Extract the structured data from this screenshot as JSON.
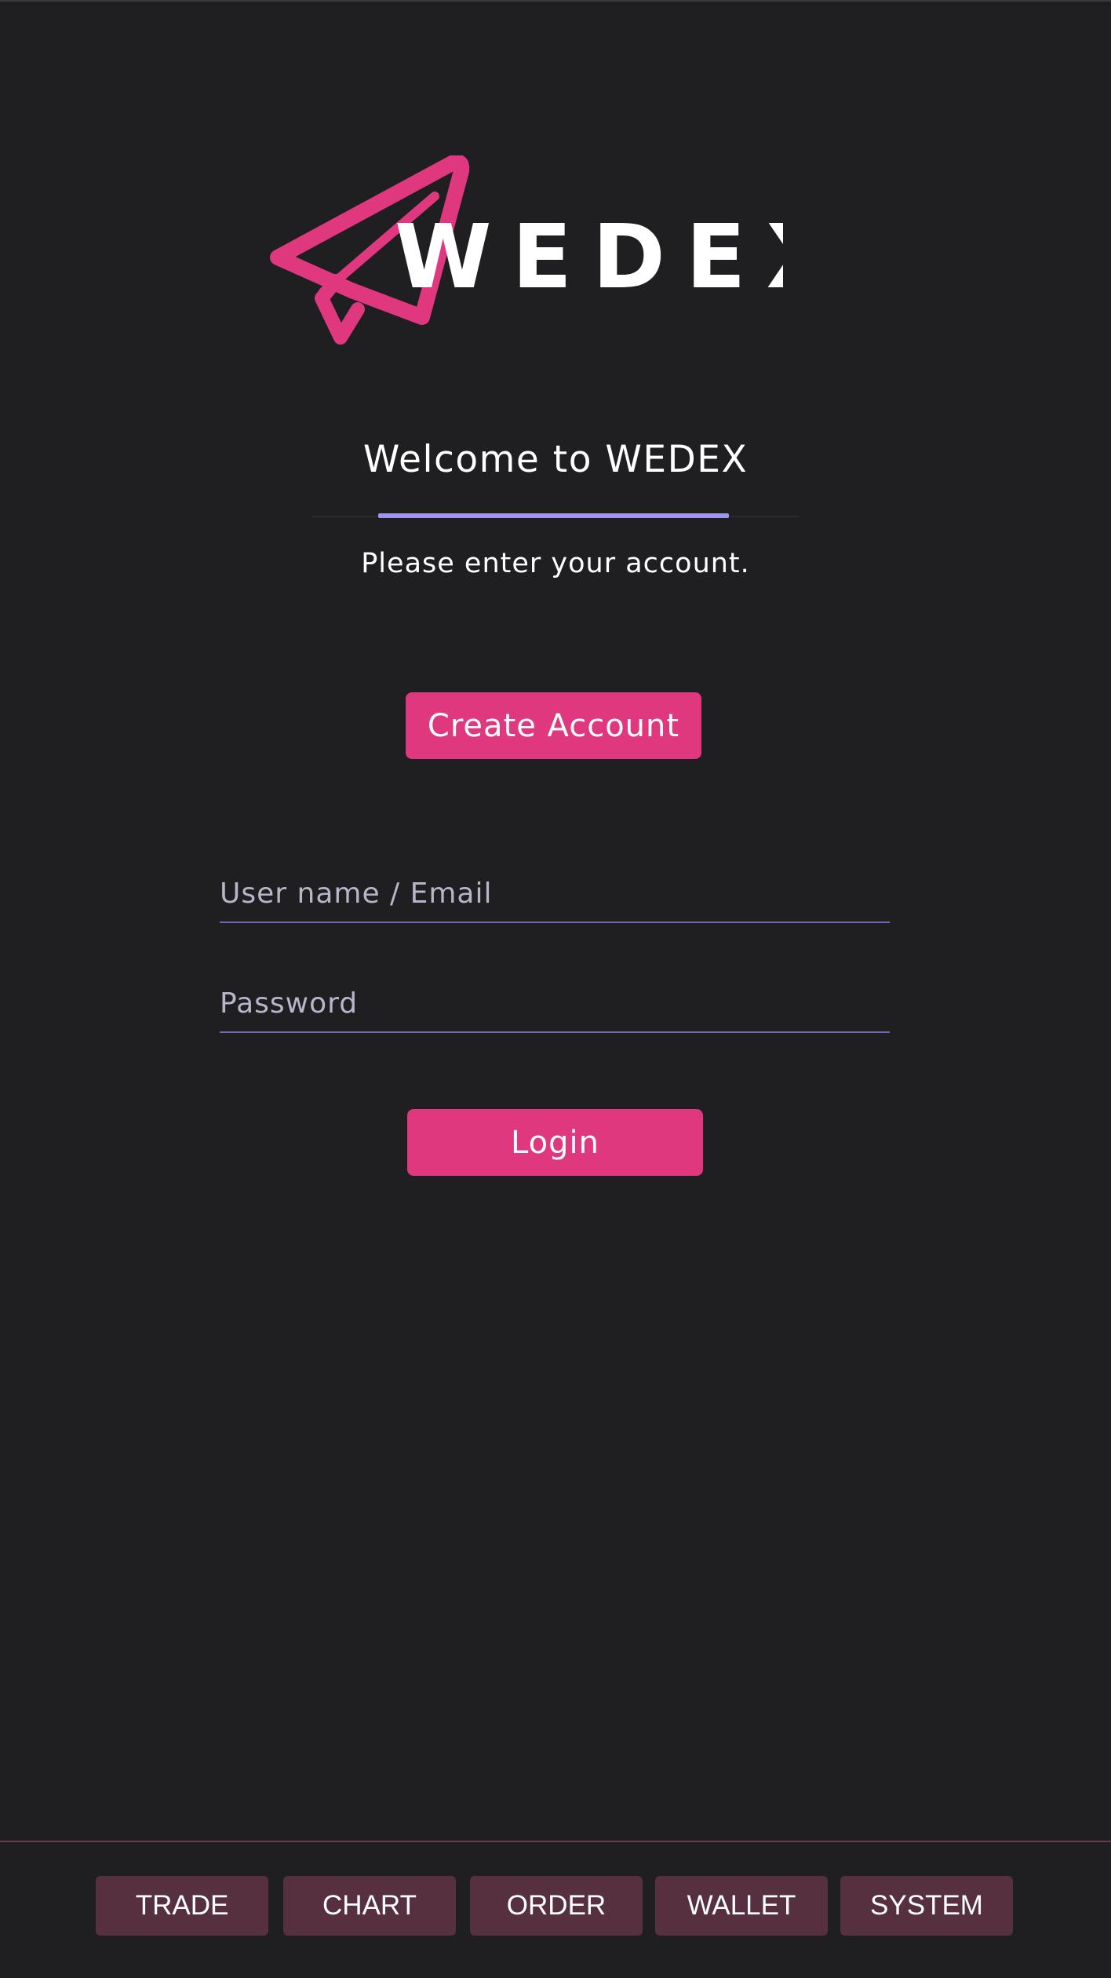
{
  "brand": {
    "name": "WEDEX",
    "logo_icon": "paper-plane-icon",
    "logo_color": "#e0387e"
  },
  "welcome": {
    "title": "Welcome to WEDEX",
    "subtitle": "Please enter your account."
  },
  "create_account": {
    "label": "Create Account"
  },
  "form": {
    "username": {
      "placeholder": "User name / Email",
      "value": ""
    },
    "password": {
      "placeholder": "Password",
      "value": ""
    },
    "login_label": "Login"
  },
  "nav": {
    "items": [
      {
        "label": "TRADE"
      },
      {
        "label": "CHART"
      },
      {
        "label": "ORDER"
      },
      {
        "label": "WALLET"
      },
      {
        "label": "SYSTEM"
      }
    ]
  },
  "colors": {
    "accent": "#e0387e",
    "highlight": "#9d96ee",
    "background": "#1f1f21",
    "nav_button": "#56303f"
  }
}
